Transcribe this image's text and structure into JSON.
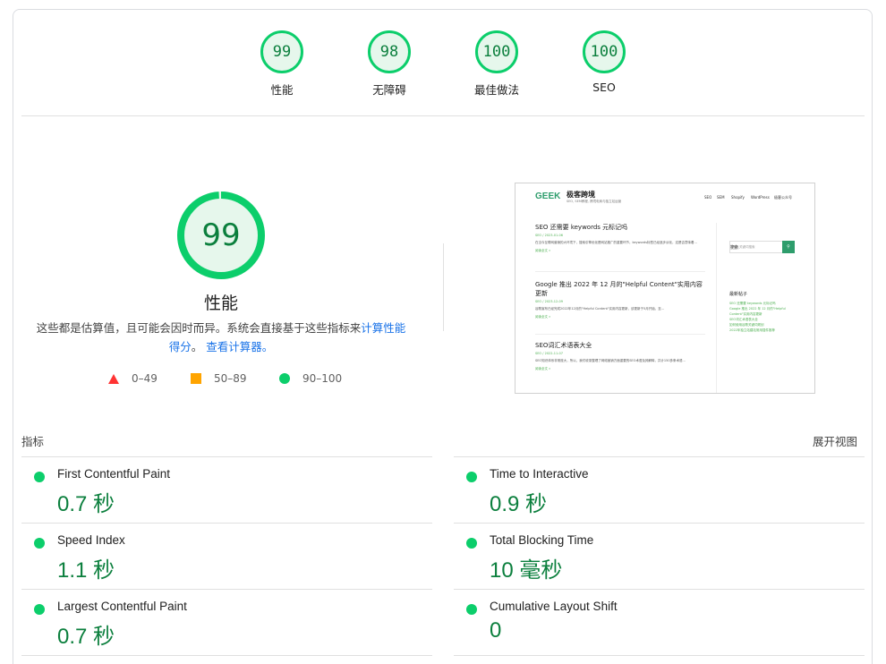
{
  "gauges": [
    {
      "score": "99",
      "label": "性能"
    },
    {
      "score": "98",
      "label": "无障碍"
    },
    {
      "score": "100",
      "label": "最佳做法"
    },
    {
      "score": "100",
      "label": "SEO"
    }
  ],
  "performance": {
    "score": "99",
    "score_fraction": 0.99,
    "title": "性能",
    "desc_prefix": "这些都是估算值，且可能会因时而异。系统会直接基于这些指标来",
    "desc_link1": "计算性能得分",
    "desc_mid": "。",
    "desc_link2": "查看计算器。",
    "legend": [
      {
        "shape": "triangle",
        "range": "0–49",
        "color": "#ff3333"
      },
      {
        "shape": "square",
        "range": "50–89",
        "color": "#ffa400"
      },
      {
        "shape": "circle",
        "range": "90–100",
        "color": "#0cce6b"
      }
    ]
  },
  "thumbnail": {
    "logo": "GEEK",
    "site_name": "极客跨境",
    "tagline": "SEO, SEM教程, 跨境电商与独立站运营",
    "nav": [
      "SEO",
      "SEM",
      "Shopify",
      "WordPress",
      "极客公众号"
    ],
    "posts": [
      {
        "title": "SEO 还需要 keywords 元标记吗",
        "meta": "SEO / 2023-01-06",
        "excerpt": "在当今互联网营销的大环境下，搜索引擎优化是网站推广的重要环节，keywords标签已经逐步淡化，这是否意味着...",
        "more": "阅读全文 »"
      },
      {
        "title": "Google 推出 2022 年 12 月的\"Helpful Content\"实用内容更新",
        "meta": "SEO / 2023-12-09",
        "excerpt": "谷歌宣布已经完成2022年12月的\"Helpful Content\"实用内容更新，该更新于5月开始，至...",
        "more": "阅读全文 »"
      },
      {
        "title": "SEO词汇术语表大全",
        "meta": "SEO / 2022-11-07",
        "excerpt": "SEO知识体系非常庞大，所以，我们收录整理了网络营销方面重要的SEO术语及其解释，共计150多条术语...",
        "more": "阅读全文 »"
      }
    ],
    "search_head": "搜索",
    "search_placeholder": "输入关键词搜索",
    "recent_head": "最新帖子",
    "recent": [
      "SEO 还需要 keywords 元标记吗",
      "Google 推出 2022 年 12 月的\"Helpful Content\"实用内容更新",
      "SEO词汇术语表大全",
      "如何使用谷歌关键词规划",
      "2022年独立站建站常用插件推荐"
    ]
  },
  "metrics": {
    "title": "指标",
    "expand_label": "展开视图",
    "items": [
      {
        "label": "First Contentful Paint",
        "value": "0.7 秒"
      },
      {
        "label": "Time to Interactive",
        "value": "0.9 秒"
      },
      {
        "label": "Speed Index",
        "value": "1.1 秒"
      },
      {
        "label": "Total Blocking Time",
        "value": "10 毫秒"
      },
      {
        "label": "Largest Contentful Paint",
        "value": "0.7 秒"
      },
      {
        "label": "Cumulative Layout Shift",
        "value": "0"
      }
    ]
  },
  "colors": {
    "pass": "#0cce6b",
    "pass_text": "#0b7f3d",
    "average": "#ffa400",
    "fail": "#ff3333",
    "link": "#1a73e8"
  }
}
